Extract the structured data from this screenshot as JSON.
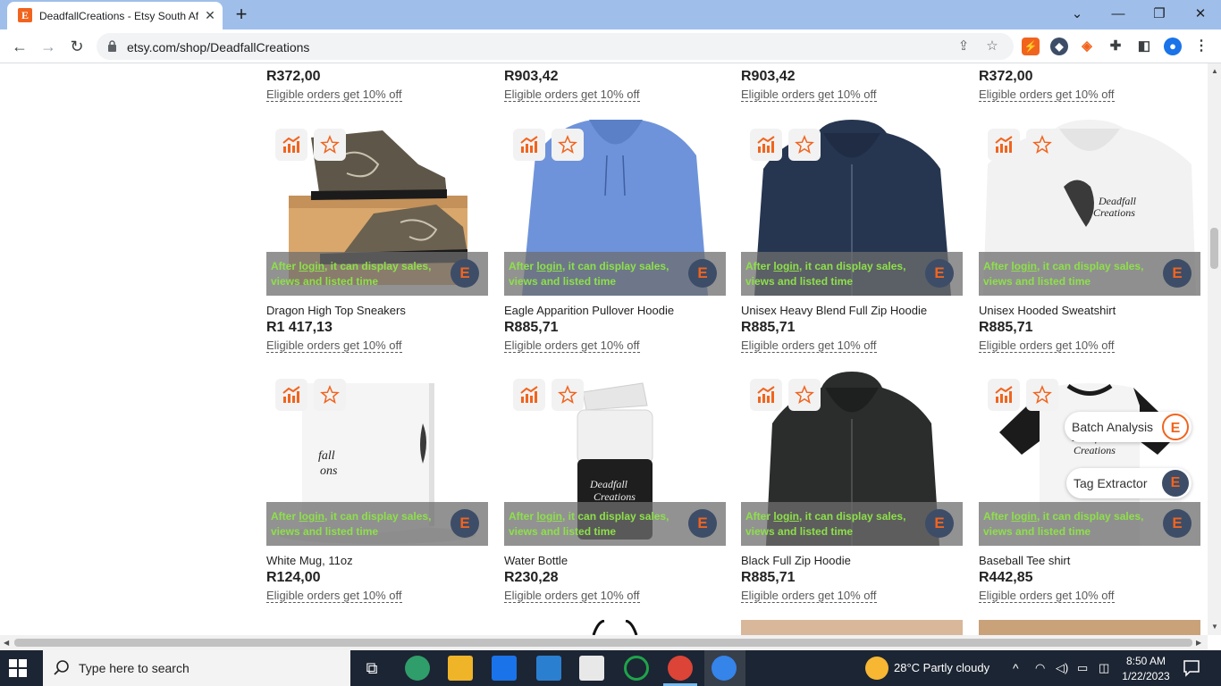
{
  "browser": {
    "tab_title": "DeadfallCreations - Etsy South Af",
    "favicon_letter": "E",
    "url": "etsy.com/shop/DeadfallCreations"
  },
  "overlay": {
    "prefix": "After ",
    "link": "login",
    "suffix": ", it can display sales, views and listed time"
  },
  "top_row": [
    {
      "price": "R372,00",
      "discount": "Eligible orders get 10% off"
    },
    {
      "price": "R903,42",
      "discount": "Eligible orders get 10% off"
    },
    {
      "price": "R903,42",
      "discount": "Eligible orders get 10% off"
    },
    {
      "price": "R372,00",
      "discount": "Eligible orders get 10% off"
    }
  ],
  "products": [
    {
      "title": "Dragon High Top Sneakers",
      "price": "R1 417,13",
      "discount": "Eligible orders get 10% off"
    },
    {
      "title": "Eagle Apparition Pullover Hoodie",
      "price": "R885,71",
      "discount": "Eligible orders get 10% off"
    },
    {
      "title": "Unisex Heavy Blend Full Zip Hoodie",
      "price": "R885,71",
      "discount": "Eligible orders get 10% off"
    },
    {
      "title": "Unisex Hooded Sweatshirt",
      "price": "R885,71",
      "discount": "Eligible orders get 10% off"
    },
    {
      "title": "White Mug, 11oz",
      "price": "R124,00",
      "discount": "Eligible orders get 10% off"
    },
    {
      "title": "Water Bottle",
      "price": "R230,28",
      "discount": "Eligible orders get 10% off"
    },
    {
      "title": "Black Full Zip Hoodie",
      "price": "R885,71",
      "discount": "Eligible orders get 10% off"
    },
    {
      "title": "Baseball Tee shirt",
      "price": "R442,85",
      "discount": "Eligible orders get 10% off"
    }
  ],
  "print_text": {
    "line1": "Deadfall",
    "line2": "Creations",
    "mug1": "fall",
    "mug2": "ons"
  },
  "floating": {
    "batch": "Batch Analysis",
    "tag": "Tag Extractor"
  },
  "taskbar": {
    "search_placeholder": "Type here to search",
    "weather": "28°C  Partly cloudy",
    "time": "8:50 AM",
    "date": "1/22/2023"
  },
  "colors": {
    "accent": "#f1641e",
    "overlay_text": "#8ee04a",
    "logo_bg": "#3d4d67"
  }
}
